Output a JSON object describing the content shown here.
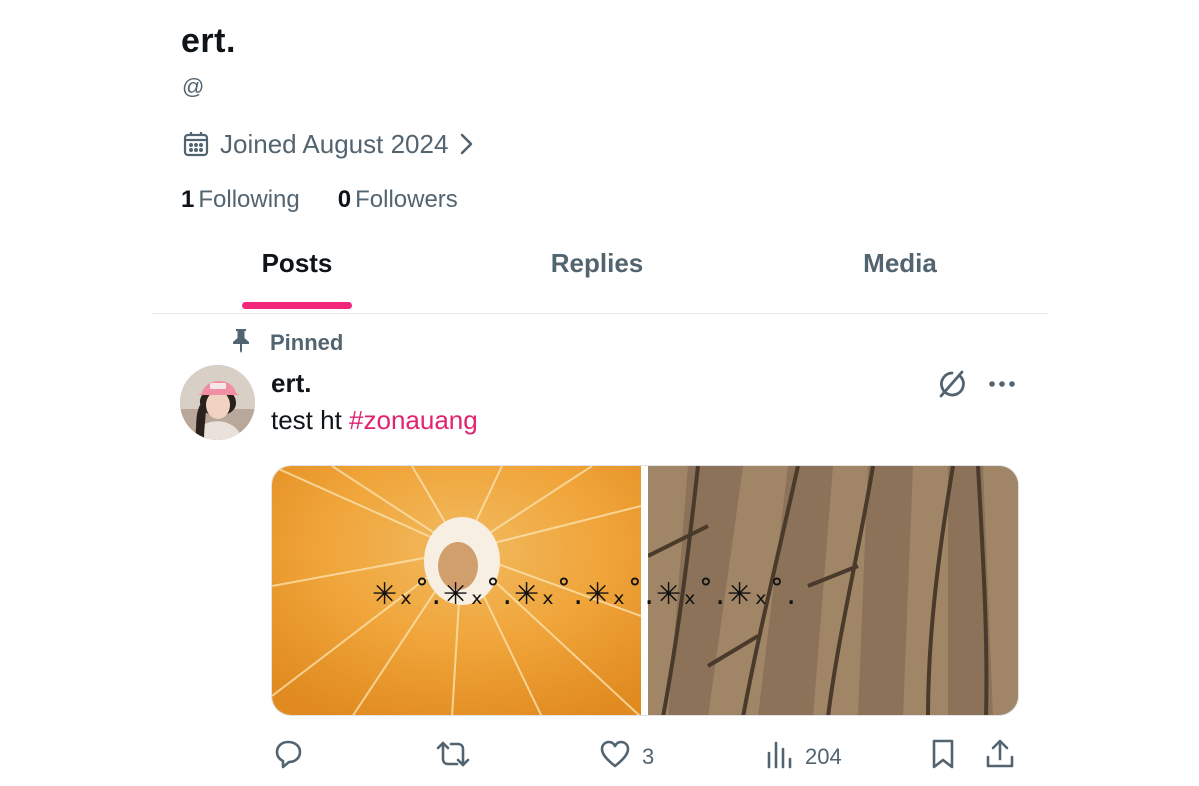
{
  "profile": {
    "display_name": "ert.",
    "handle": "@",
    "joined": "Joined August 2024",
    "following_count": "1",
    "following_label": "Following",
    "followers_count": "0",
    "followers_label": "Followers"
  },
  "tabs": [
    {
      "label": "Posts",
      "active": true
    },
    {
      "label": "Replies",
      "active": false
    },
    {
      "label": "Media",
      "active": false
    }
  ],
  "post": {
    "pinned_label": "Pinned",
    "author": "ert.",
    "text": "test ht ",
    "hashtag": "#zonauang",
    "media_overlay_text": "✳ₓ˚.✳ₓ˚.✳ₓ˚.✳ₓ˚.✳ₓ˚.✳ₓ˚.",
    "likes": "3",
    "views": "204"
  },
  "colors": {
    "accent": "#f2277a",
    "hashtag": "#e0246f",
    "secondary_text": "#536471",
    "primary_text": "#0f1419"
  },
  "icons": [
    "calendar-icon",
    "chevron-right-icon",
    "pin-icon",
    "grok-icon",
    "more-icon",
    "reply-icon",
    "repost-icon",
    "like-icon",
    "views-icon",
    "bookmark-icon",
    "share-icon"
  ]
}
